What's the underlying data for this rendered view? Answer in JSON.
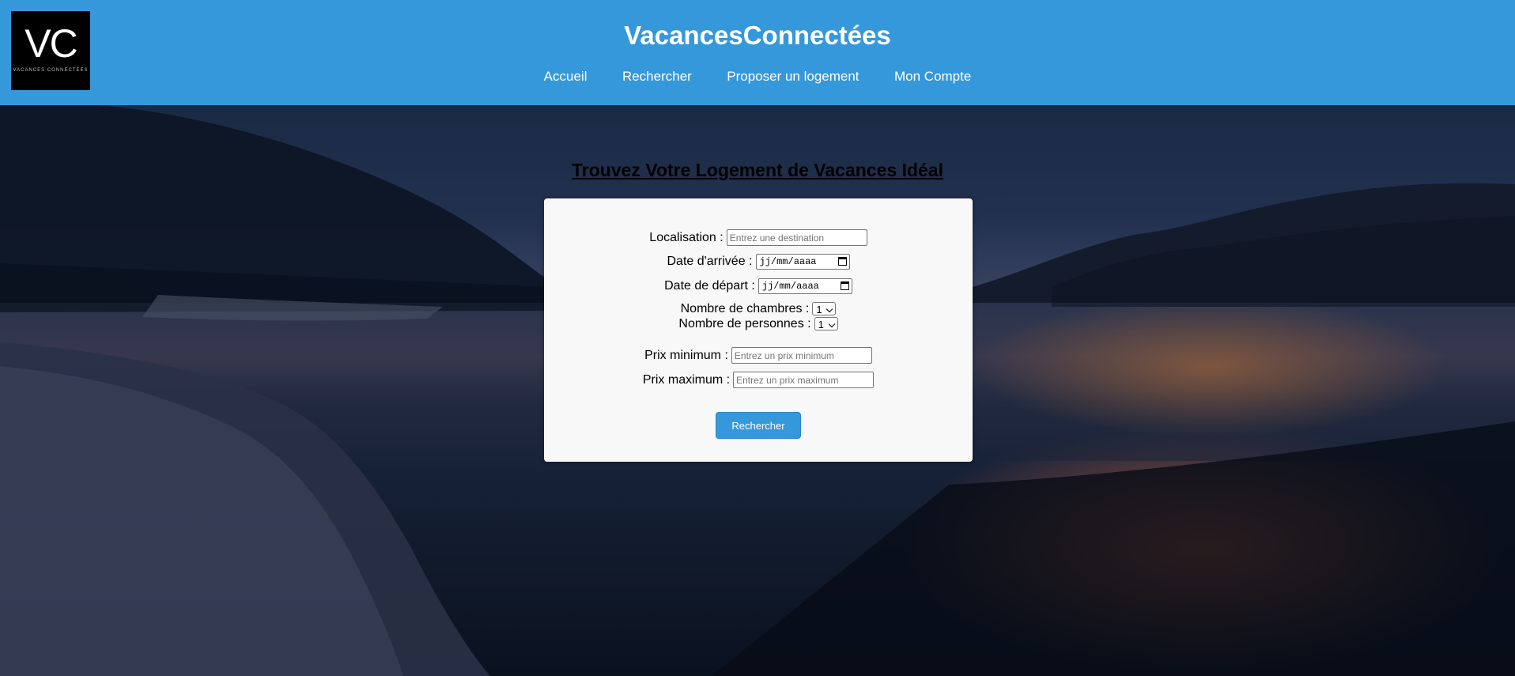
{
  "header": {
    "logo": {
      "monogram": "VC",
      "tagline": "VACANCES CONNECTÉES"
    },
    "site_title": "VacancesConnectées",
    "nav": [
      {
        "label": "Accueil"
      },
      {
        "label": "Rechercher"
      },
      {
        "label": "Proposer un logement"
      },
      {
        "label": "Mon Compte"
      }
    ],
    "bg_color": "#3598db"
  },
  "main": {
    "heading": "Trouvez Votre Logement de Vacances Idéal",
    "form": {
      "location": {
        "label": "Localisation :",
        "placeholder": "Entrez une destination"
      },
      "arrival": {
        "label": "Date d'arrivée :",
        "value": "jj/mm/aaaa"
      },
      "departure": {
        "label": "Date de départ :",
        "value": "jj/mm/aaaa"
      },
      "rooms": {
        "label": "Nombre de chambres :",
        "value": "1"
      },
      "persons": {
        "label": "Nombre de personnes :",
        "value": "1"
      },
      "min_price": {
        "label": "Prix minimum :",
        "placeholder": "Entrez un prix minimum"
      },
      "max_price": {
        "label": "Prix maximum :",
        "placeholder": "Entrez un prix maximum"
      },
      "submit_label": "Rechercher"
    }
  },
  "colors": {
    "accent": "#3598db",
    "card": "#f8f8f8"
  }
}
